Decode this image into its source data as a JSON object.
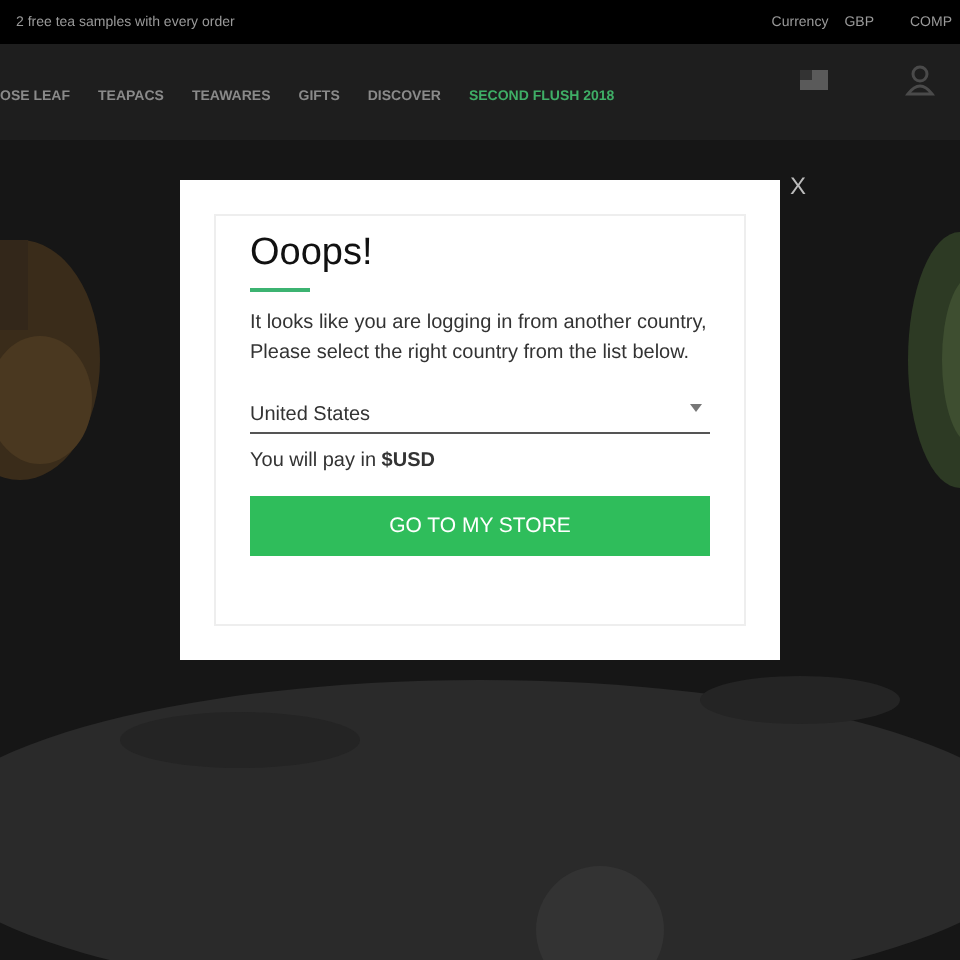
{
  "top_bar": {
    "promo": "2 free tea samples with every order",
    "currency_label": "Currency",
    "currency": "GBP",
    "account": "COMP"
  },
  "nav": {
    "items": [
      {
        "label": "OSE LEAF",
        "highlight": false
      },
      {
        "label": "TEAPACS",
        "highlight": false
      },
      {
        "label": "TEAWARES",
        "highlight": false
      },
      {
        "label": "GIFTS",
        "highlight": false
      },
      {
        "label": "DISCOVER",
        "highlight": false
      },
      {
        "label": "SECOND FLUSH 2018",
        "highlight": true
      }
    ]
  },
  "modal": {
    "title": "Ooops!",
    "message": "It looks like you are logging in from another country, Please select the right country from the list below.",
    "country": "United States",
    "payment_note": "You will pay in **$USD**",
    "button": "GO TO MY STORE",
    "close": "X"
  }
}
